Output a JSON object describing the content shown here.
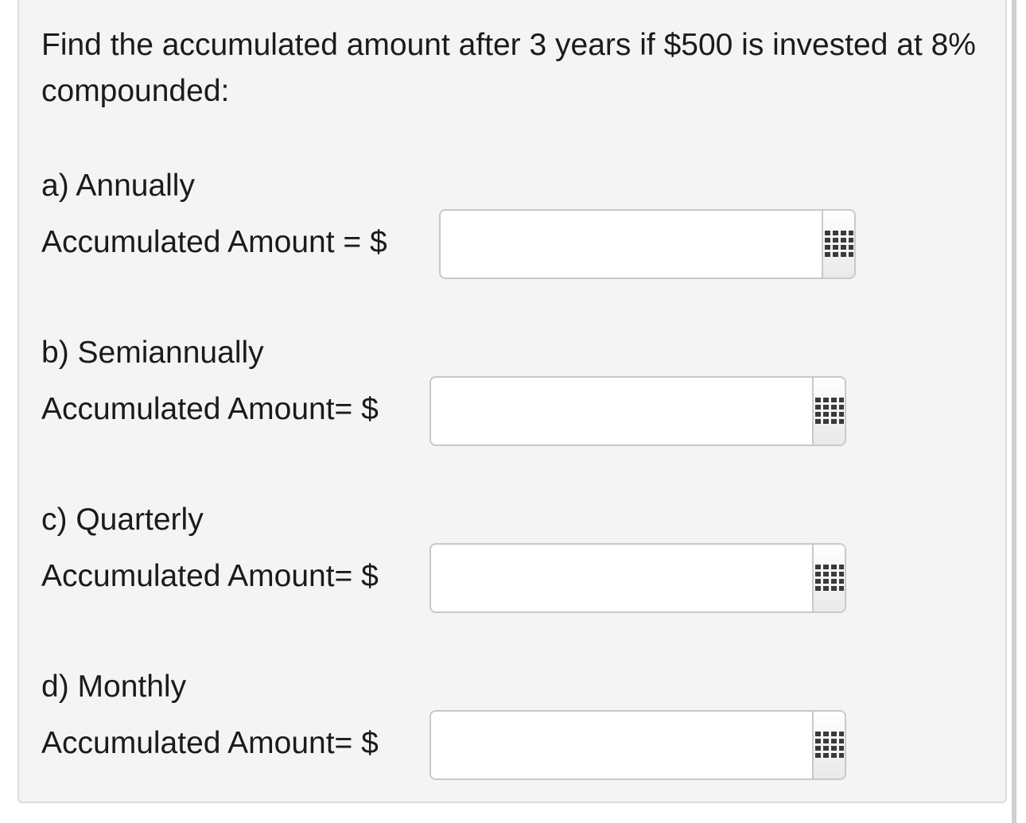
{
  "question": {
    "text": "Find the accumulated amount after 3 years if $500 is invested at 8% compounded:"
  },
  "parts": [
    {
      "heading": "a) Annually",
      "label": "Accumulated Amount = $",
      "value": "",
      "keypad_icon": "keypad-icon"
    },
    {
      "heading": "b) Semiannually",
      "label": "Accumulated Amount= $",
      "value": "",
      "keypad_icon": "keypad-icon"
    },
    {
      "heading": "c) Quarterly",
      "label": "Accumulated Amount= $",
      "value": "",
      "keypad_icon": "keypad-icon"
    },
    {
      "heading": "d) Monthly",
      "label": "Accumulated Amount= $",
      "value": "",
      "keypad_icon": "keypad-icon"
    }
  ]
}
